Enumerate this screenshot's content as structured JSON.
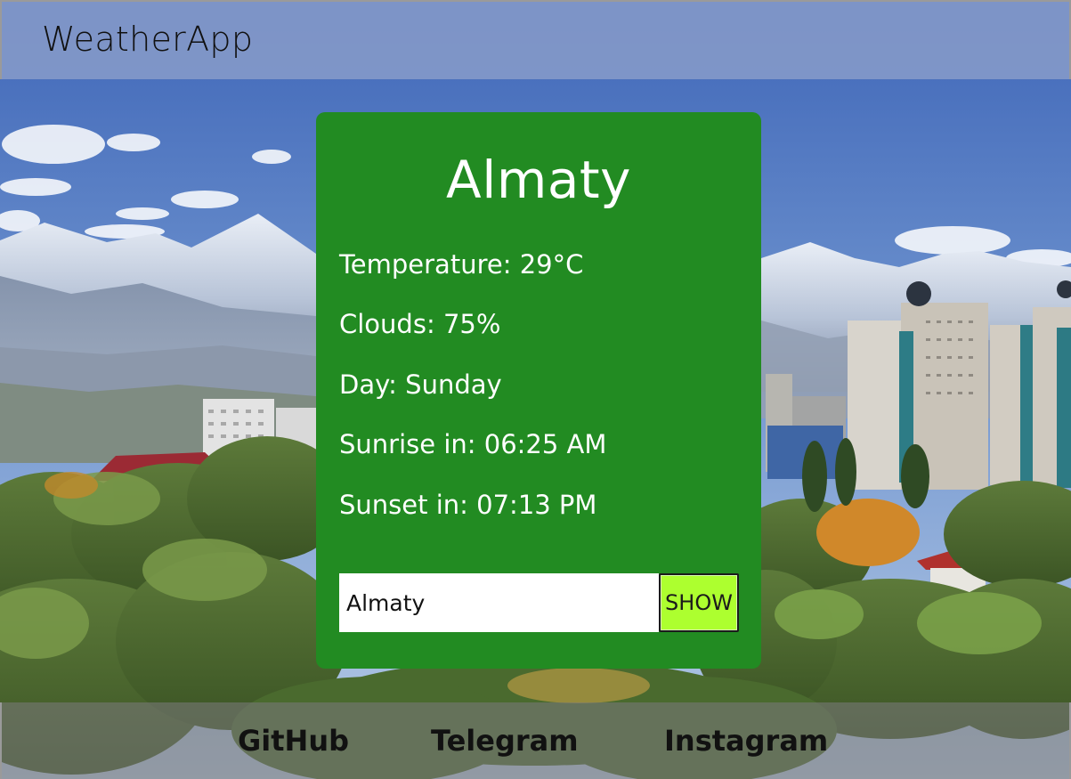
{
  "header": {
    "brand": "WeatherApp"
  },
  "weather": {
    "city": "Almaty",
    "temperature": {
      "label": "Temperature: ",
      "value": "29°C"
    },
    "clouds": {
      "label": "Clouds: ",
      "value": "75%"
    },
    "day": {
      "label": "Day: ",
      "value": "Sunday"
    },
    "sunrise": {
      "label": "Sunrise in: ",
      "value": "06:25 AM"
    },
    "sunset": {
      "label": "Sunset in: ",
      "value": "07:13 PM"
    }
  },
  "search": {
    "value": "Almaty",
    "button_label": "SHOW"
  },
  "footer": {
    "links": [
      "GitHub",
      "Telegram",
      "Instagram"
    ]
  },
  "colors": {
    "card": "#228b22",
    "button": "#adff2f",
    "header": "#8298c8"
  }
}
